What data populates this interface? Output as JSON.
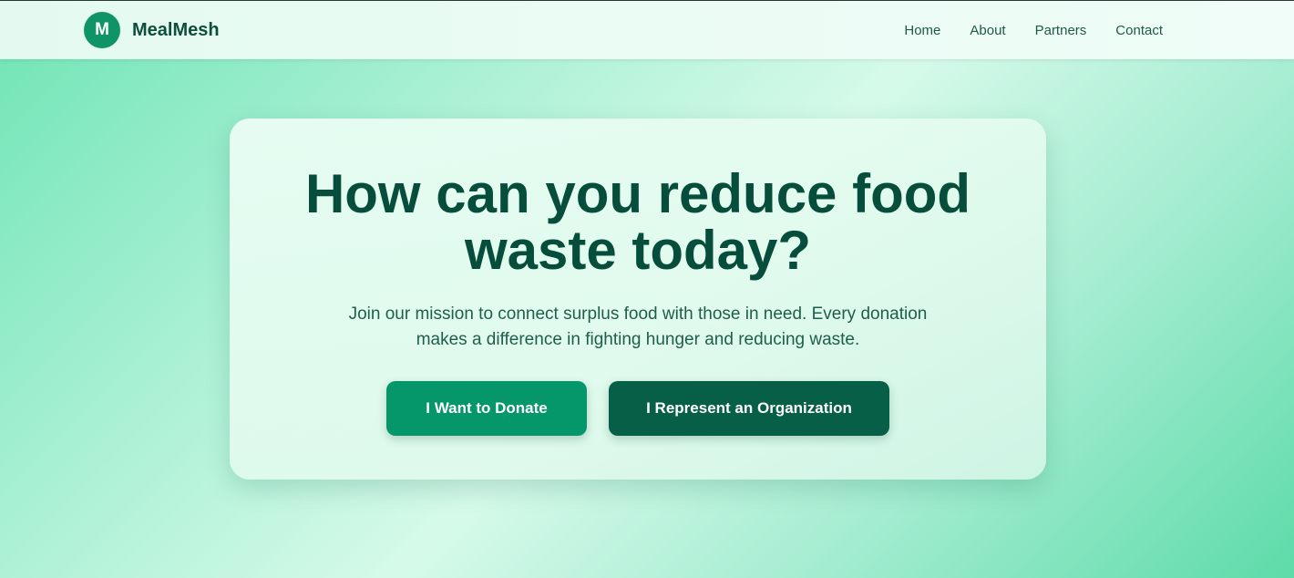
{
  "brand": {
    "logo_letter": "M",
    "name": "MealMesh"
  },
  "nav": {
    "items": [
      {
        "label": "Home"
      },
      {
        "label": "About"
      },
      {
        "label": "Partners"
      },
      {
        "label": "Contact"
      }
    ]
  },
  "hero": {
    "title": "How can you reduce food waste today?",
    "subtitle": "Join our mission to connect surplus food with those in need. Every donation makes a difference in fighting hunger and reducing waste.",
    "primary_button": "I Want to Donate",
    "secondary_button": "I Represent an Organization"
  },
  "colors": {
    "brand_green": "#059669",
    "dark_green": "#065f46",
    "heading_text": "#064e3b"
  }
}
